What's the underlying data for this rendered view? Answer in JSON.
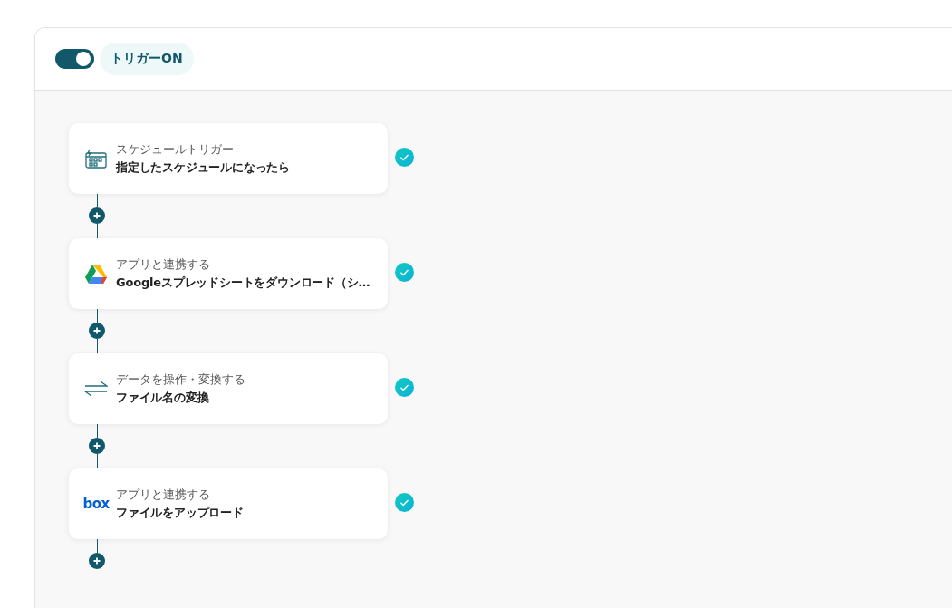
{
  "header": {
    "trigger_toggle": {
      "on": true
    },
    "trigger_label": "トリガーON"
  },
  "steps": [
    {
      "kind": "schedule",
      "category": "スケジュールトリガー",
      "title": "指定したスケジュールになったら",
      "done": true
    },
    {
      "kind": "drive",
      "category": "アプリと連携する",
      "title": "Googleスプレッドシートをダウンロード（シ…",
      "done": true
    },
    {
      "kind": "transform",
      "category": "データを操作・変換する",
      "title": "ファイル名の変換",
      "done": true
    },
    {
      "kind": "box",
      "category": "アプリと連携する",
      "title": "ファイルをアップロード",
      "done": true,
      "logo_text": "box"
    }
  ]
}
